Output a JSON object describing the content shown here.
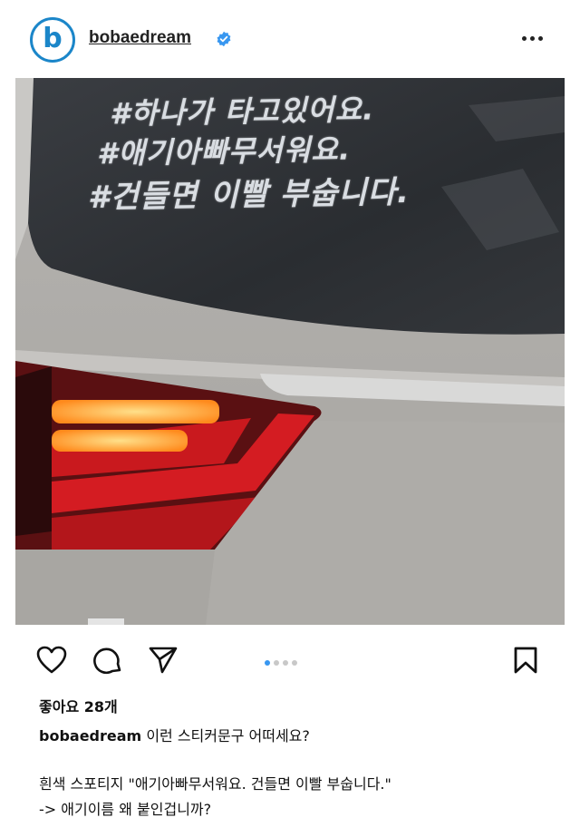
{
  "post": {
    "username": "bobaedream",
    "avatar_letter": "b",
    "verified_icon": "verified-badge-icon",
    "more_icon": "more-options-icon"
  },
  "photo": {
    "sticker_lines": [
      "#하나가 타고있어요.",
      "#애기아빠무서워요.",
      "#건들면 이빨 부숩니다."
    ],
    "colors": {
      "window": "#2f3236",
      "body": "#b9b7b3",
      "taillight": "#c0191d",
      "led": "#ffb23a"
    }
  },
  "actions": {
    "like_icon": "heart-icon",
    "comment_icon": "comment-icon",
    "share_icon": "send-icon",
    "save_icon": "bookmark-icon",
    "carousel_count": 4,
    "carousel_active": 0
  },
  "likes_text": "좋아요 28개",
  "caption": {
    "username": "bobaedream",
    "text": "이런 스티커문구 어떠세요?",
    "line2": "흰색 스포티지 \"애기아빠무서워요. 건들면 이빨 부숩니다.\"",
    "line3": "-> 애기이름 왜 붙인겁니까?"
  }
}
